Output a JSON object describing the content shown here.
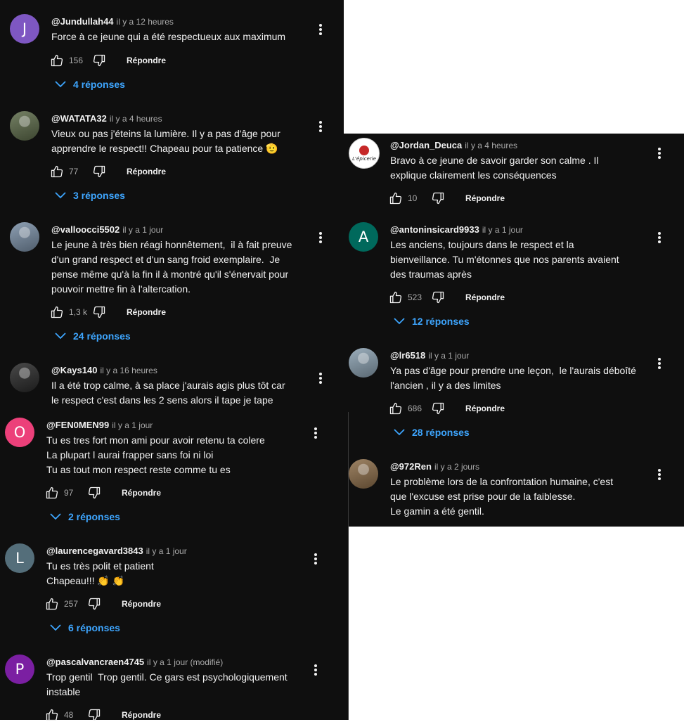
{
  "labels": {
    "reply": "Répondre"
  },
  "colors": {
    "background": "#0f0f0f",
    "link": "#3ea6ff",
    "muted": "#aaaaaa"
  },
  "left_panel": {
    "comments": [
      {
        "author": "@Jundullah44",
        "time": "il y a 12 heures",
        "avatar_letter": "J",
        "avatar_color": "#7e57c2",
        "text": "Force à ce jeune qui a été respectueux aux maximum",
        "likes": "156",
        "replies": "4 réponses"
      },
      {
        "author": "@WATATA32",
        "time": "il y a 4 heures",
        "avatar_letter": "",
        "avatar_color": "#5d6b4a",
        "text": "Vieux ou pas j'éteins la lumière. Il y a pas d'âge pour\napprendre le respect!! Chapeau pour ta patience 🫡",
        "likes": "77",
        "replies": "3 réponses"
      },
      {
        "author": "@valloocci5502",
        "time": "il y a 1 jour",
        "avatar_letter": "",
        "avatar_color": "#7a8fa6",
        "text": "Le jeune à très bien réagi honnêtement,  il à fait preuve\nd'un grand respect et d'un sang froid exemplaire.  Je\npense même qu'à la fin il à montré qu'il s'énervait pour\npouvoir mettre fin à l'altercation.",
        "likes": "1,3 k",
        "replies": "24 réponses"
      },
      {
        "author": "@Kays140",
        "time": "il y a 16 heures",
        "avatar_letter": "",
        "avatar_color": "#2a2a2a",
        "text": "Il a été trop calme, à sa place j'aurais agis plus tôt car\nle respect c'est dans les 2 sens alors il tape je tape"
      },
      {
        "author": "@FEN0MEN99",
        "time": "il y a 1 jour",
        "avatar_letter": "O",
        "avatar_color": "#ec407a",
        "text": "Tu es tres fort mon ami pour avoir retenu ta colere\nLa plupart l aurai frapper sans foi ni loi\nTu as tout mon respect reste comme tu es",
        "likes": "97",
        "replies": "2 réponses"
      },
      {
        "author": "@laurencegavard3843",
        "time": "il y a 1 jour",
        "avatar_letter": "L",
        "avatar_color": "#546e7a",
        "text": "Tu es très polit et patient\nChapeau!!! 👏 👏",
        "likes": "257",
        "replies": "6 réponses"
      },
      {
        "author": "@pascalvancraen4745",
        "time": "il y a 1 jour (modifié)",
        "avatar_letter": "P",
        "avatar_color": "#7b1fa2",
        "text": "Trop gentil  Trop gentil. Ce gars est psychologiquement\ninstable",
        "likes": "48"
      }
    ]
  },
  "right_panel": {
    "comments": [
      {
        "author": "@Jordan_Deuca",
        "time": "il y a 4 heures",
        "avatar_letter": "",
        "avatar_label": "L'épicerie",
        "avatar_color": "#ffffff",
        "text": "Bravo à ce jeune de savoir garder son calme . Il\nexplique clairement les conséquences",
        "likes": "10"
      },
      {
        "author": "@antoninsicard9933",
        "time": "il y a 1 jour",
        "avatar_letter": "A",
        "avatar_color": "#00695c",
        "text": "Les anciens, toujours dans le respect et la\nbienveillance. Tu m'étonnes que nos parents avaient\ndes traumas après",
        "likes": "523",
        "replies": "12 réponses"
      },
      {
        "author": "@lr6518",
        "time": "il y a 1 jour",
        "avatar_letter": "",
        "avatar_color": "#8aa0b0",
        "text": "Ya pas d'âge pour prendre une leçon,  le l'aurais déboîté\nl'ancien , il y a des limites",
        "likes": "686",
        "replies": "28 réponses"
      },
      {
        "author": "@972Ren",
        "time": "il y a 2 jours",
        "avatar_letter": "",
        "avatar_color": "#8d6e4a",
        "text": "Le problème lors de la confrontation humaine, c'est\nque l'excuse est prise pour de la faiblesse.\nLe gamin a été gentil."
      }
    ]
  }
}
